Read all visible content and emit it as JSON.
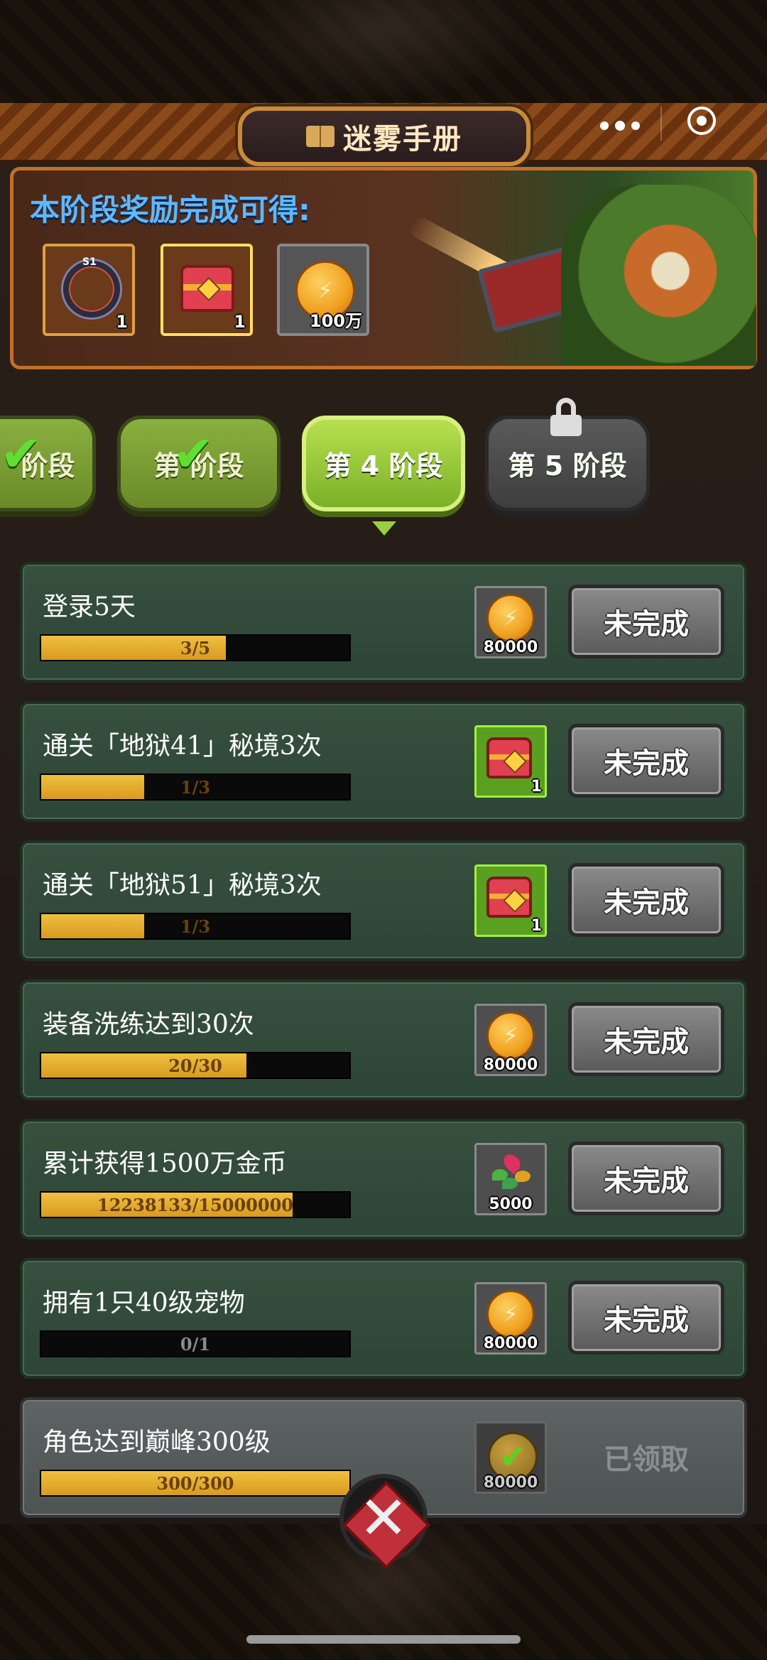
{
  "header": {
    "title": "迷雾手册",
    "icons": [
      "book-icon",
      "more-icon",
      "target-icon"
    ]
  },
  "reward_banner": {
    "title": "本阶段奖励完成可得:",
    "items": [
      {
        "icon": "ring-icon",
        "badge": "S1",
        "quantity": "1"
      },
      {
        "icon": "chest-icon",
        "quantity": "1"
      },
      {
        "icon": "gold-coin-icon",
        "quantity": "100万"
      }
    ]
  },
  "stages": {
    "tabs": [
      {
        "label": "阶段",
        "state": "completed"
      },
      {
        "label": "第 阶段",
        "state": "completed"
      },
      {
        "label": "第 4 阶段",
        "state": "active"
      },
      {
        "label": "第 5 阶段",
        "state": "locked"
      }
    ]
  },
  "tasks": [
    {
      "title": "登录5天",
      "progress_text": "3/5",
      "progress": 0.6,
      "reward_icon": "gold-coin-icon",
      "reward_qty": "80000",
      "status": "未完成"
    },
    {
      "title": "通关「地狱41」秘境3次",
      "progress_text": "1/3",
      "progress": 0.333,
      "reward_icon": "chest-icon",
      "reward_qty": "1",
      "status": "未完成"
    },
    {
      "title": "通关「地狱51」秘境3次",
      "progress_text": "1/3",
      "progress": 0.333,
      "reward_icon": "chest-icon",
      "reward_qty": "1",
      "status": "未完成"
    },
    {
      "title": "装备洗练达到30次",
      "progress_text": "20/30",
      "progress": 0.667,
      "reward_icon": "gold-coin-icon",
      "reward_qty": "80000",
      "status": "未完成"
    },
    {
      "title": "累计获得1500万金币",
      "progress_text": "12238133/15000000",
      "progress": 0.816,
      "reward_icon": "flower-icon",
      "reward_qty": "5000",
      "status": "未完成"
    },
    {
      "title": "拥有1只40级宠物",
      "progress_text": "0/1",
      "progress": 0,
      "reward_icon": "gold-coin-icon",
      "reward_qty": "80000",
      "status": "未完成"
    },
    {
      "title": "角色达到巅峰300级",
      "progress_text": "300/300",
      "progress": 1.0,
      "reward_icon": "claimed-coin-icon",
      "reward_qty": "80000",
      "status": "已领取"
    }
  ],
  "colors": {
    "accent_green": "#9ad040",
    "title_blue": "#5fb8ff",
    "progress_gold": "#f0c040",
    "card_green": "#37503e"
  }
}
